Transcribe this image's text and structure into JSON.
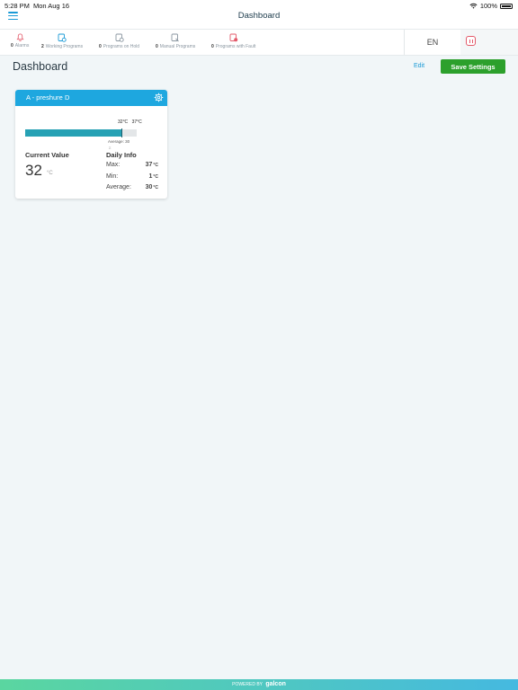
{
  "status_bar": {
    "time": "5:28 PM",
    "date": "Mon Aug 16",
    "battery": "100%"
  },
  "nav": {
    "title": "Dashboard",
    "menu_icon": "hamburger-menu-icon"
  },
  "toolbar": {
    "items": [
      {
        "count": "0",
        "label": "Alarms",
        "icon": "bell-icon",
        "color": "#e35a6a"
      },
      {
        "count": "2",
        "label": "Working Programs",
        "icon": "program-running-icon",
        "color": "#1a9ad6"
      },
      {
        "count": "0",
        "label": "Programs on Hold",
        "icon": "program-hold-icon",
        "color": "#8a96a0"
      },
      {
        "count": "0",
        "label": "Manual Programs",
        "icon": "program-manual-icon",
        "color": "#8a96a0"
      },
      {
        "count": "0",
        "label": "Programs with Fault",
        "icon": "program-fault-icon",
        "color": "#e35a6a"
      }
    ],
    "language": "EN"
  },
  "header": {
    "title": "Dashboard",
    "edit_label": "Edit",
    "save_label": "Save Settings"
  },
  "widget": {
    "title": "A - preshure D",
    "bar": {
      "current_label": "32",
      "current_unit": "°C",
      "max_label": "37",
      "max_unit": "°C",
      "average_label": "Average: 30",
      "fill_fraction": 0.86,
      "avg_mark": "Σ"
    },
    "current_value": {
      "title": "Current Value",
      "value": "32",
      "unit": "°C"
    },
    "daily_info": {
      "title": "Daily Info",
      "rows": [
        {
          "label": "Max:",
          "value": "37",
          "unit": "°C"
        },
        {
          "label": "Min:",
          "value": "1",
          "unit": "°C"
        },
        {
          "label": "Average:",
          "value": "30",
          "unit": "°C"
        }
      ]
    }
  },
  "footer": {
    "powered_by": "POWERED BY",
    "brand": "galcon"
  },
  "colors": {
    "accent": "#1ea7df",
    "save": "#2ca02c",
    "bar_fill": "#26a1b4",
    "alert": "#e35a6a"
  }
}
